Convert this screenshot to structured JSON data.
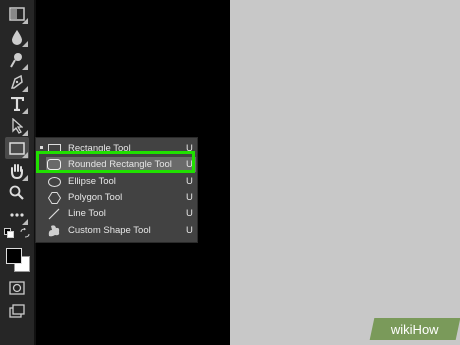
{
  "toolbar": {
    "tools": [
      {
        "name": "gradient-tool-icon"
      },
      {
        "name": "blur-tool-icon"
      },
      {
        "name": "dodge-tool-icon"
      },
      {
        "name": "pen-tool-icon"
      },
      {
        "name": "type-tool-icon"
      },
      {
        "name": "path-selection-tool-icon"
      },
      {
        "name": "shape-tool-icon"
      },
      {
        "name": "hand-tool-icon"
      },
      {
        "name": "zoom-tool-icon"
      },
      {
        "name": "more-tools-icon"
      }
    ]
  },
  "shape_menu": {
    "items": [
      {
        "label": "Rectangle Tool",
        "key": "U",
        "icon": "rectangle-icon"
      },
      {
        "label": "Rounded Rectangle Tool",
        "key": "U",
        "icon": "rounded-rectangle-icon"
      },
      {
        "label": "Ellipse Tool",
        "key": "U",
        "icon": "ellipse-icon"
      },
      {
        "label": "Polygon Tool",
        "key": "U",
        "icon": "polygon-icon"
      },
      {
        "label": "Line Tool",
        "key": "U",
        "icon": "line-icon"
      },
      {
        "label": "Custom Shape Tool",
        "key": "U",
        "icon": "custom-shape-icon"
      }
    ],
    "selected_index": 1,
    "highlight_color": "#20e000"
  },
  "watermark": {
    "text": "wikiHow"
  }
}
